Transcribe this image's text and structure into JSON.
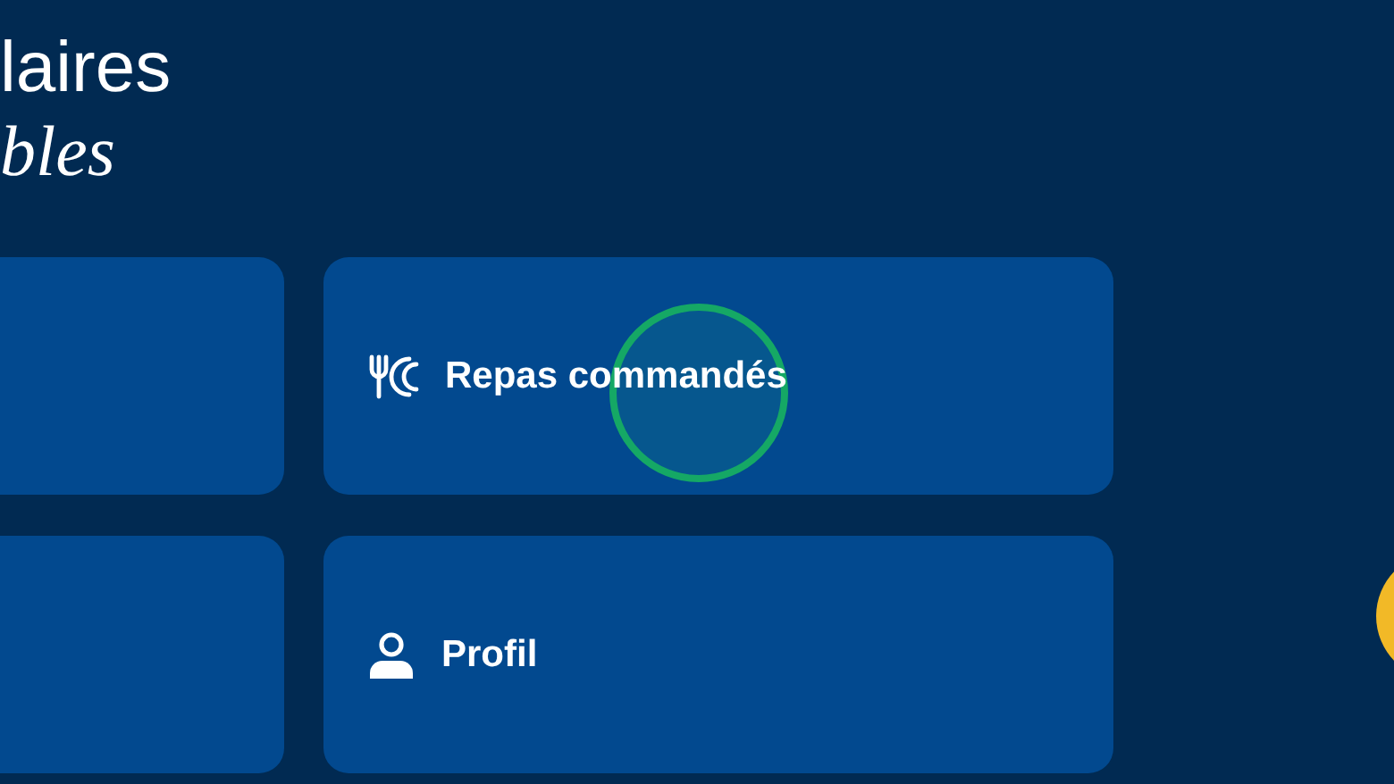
{
  "heading": {
    "line_1": "laires",
    "line_2": "bles"
  },
  "cards": [
    {
      "kind": "empty"
    },
    {
      "kind": "meals",
      "label": "Repas commandés"
    },
    {
      "kind": "empty"
    },
    {
      "kind": "profile",
      "label": "Profil"
    }
  ]
}
